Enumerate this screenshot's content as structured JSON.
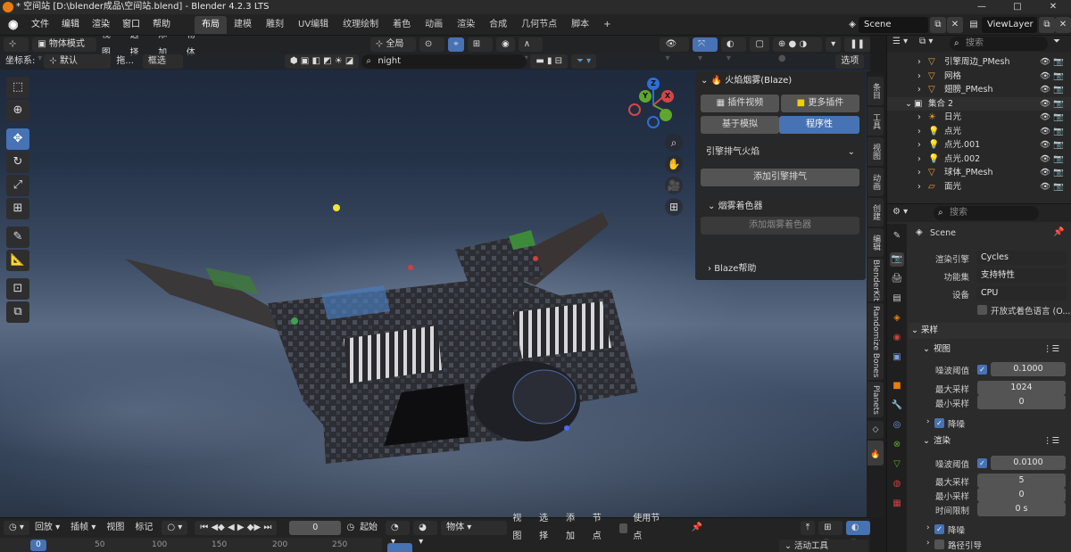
{
  "window": {
    "title": "* 空间站 [D:\\blender成品\\空间站.blend] - Blender 4.2.3 LTS",
    "controls": [
      "—",
      "□",
      "✕"
    ]
  },
  "menu": [
    "文件",
    "编辑",
    "渲染",
    "窗口",
    "帮助"
  ],
  "workspaces": [
    "布局",
    "建模",
    "雕刻",
    "UV编辑",
    "纹理绘制",
    "着色",
    "动画",
    "渲染",
    "合成",
    "几何节点",
    "脚本"
  ],
  "active_workspace": "布局",
  "scene": {
    "name": "Scene",
    "view_layer": "ViewLayer"
  },
  "viewport_header": {
    "mode": "物体模式",
    "menus": [
      "视图",
      "选择",
      "添加",
      "物体"
    ],
    "transform_orientation": "全局"
  },
  "viewport_header2": {
    "coord_label": "坐标系:",
    "coord_value": "默认",
    "drag_label": "拖...",
    "select_value": "框选",
    "search_value": "night",
    "options": "选项"
  },
  "tools": [
    "select-box",
    "cursor",
    "move",
    "rotate",
    "scale",
    "transform",
    "annotate",
    "measure",
    "add-cube",
    "extrude"
  ],
  "gizmo": {
    "z": "Z",
    "y": "Y",
    "x": "X"
  },
  "npanel": {
    "title": "火焰烟雾(Blaze)",
    "btn_video": "插件视频",
    "btn_more": "更多插件",
    "tab_basic": "基于模拟",
    "tab_procedural": "程序性",
    "dropdown": "引擎排气火焰",
    "add_exhaust": "添加引擎排气",
    "section_smoke": "烟雾着色器",
    "add_smoke": "添加烟雾着色器",
    "section_help": "Blaze帮助"
  },
  "side_tabs": [
    "条目",
    "工具",
    "视图",
    "动画",
    "创建",
    "编辑",
    "BlenderKit",
    "Randomize Bones",
    "Planets"
  ],
  "outliner": {
    "search_placeholder": "搜索",
    "rows": [
      {
        "name": "引擎周边_PMesh",
        "icon": "▽"
      },
      {
        "name": "网格",
        "icon": "▽"
      },
      {
        "name": "翅膀_PMesh",
        "icon": "▽"
      },
      {
        "name": "集合 2",
        "icon": "▣"
      },
      {
        "name": "日光",
        "icon": "☀"
      },
      {
        "name": "点光",
        "icon": "💡"
      },
      {
        "name": "点光.001",
        "icon": "💡"
      },
      {
        "name": "点光.002",
        "icon": "💡"
      },
      {
        "name": "球体_PMesh",
        "icon": "▽"
      },
      {
        "name": "面光",
        "icon": "▱"
      }
    ]
  },
  "properties": {
    "search_placeholder": "搜索",
    "scene_name": "Scene",
    "render_engine_label": "渲染引擎",
    "render_engine": "Cycles",
    "feature_set_label": "功能集",
    "feature_set": "支持特性",
    "device_label": "设备",
    "device": "CPU",
    "osl_label": "开放式着色语言 (O...",
    "sampling": "采样",
    "viewport_section": "视图",
    "noise_threshold_label": "噪波阈值",
    "viewport_noise_threshold": "0.1000",
    "max_samples_label": "最大采样",
    "viewport_max_samples": "1024",
    "min_samples_label": "最小采样",
    "viewport_min_samples": "0",
    "denoise": "降噪",
    "render_section": "渲染",
    "render_noise_threshold": "0.0100",
    "render_max_samples": "5",
    "render_min_samples": "0",
    "time_limit_label": "时间限制",
    "time_limit": "0 s",
    "denoise2": "降噪",
    "path_guiding": "路径引导"
  },
  "timeline": {
    "playback": "回放",
    "keying": "插帧",
    "view": "视图",
    "marker": "标记",
    "current_frame": "0",
    "start_label": "起始",
    "ticks": [
      "0",
      "50",
      "100",
      "150",
      "200",
      "250"
    ]
  },
  "node_editor": {
    "object": "物体",
    "menus": [
      "视图",
      "选择",
      "添加",
      "节点"
    ],
    "use_nodes": "使用节点",
    "active_tool": "活动工具"
  },
  "colors": {
    "accent": "#4772b3",
    "blender_orange": "#e87d0d"
  }
}
